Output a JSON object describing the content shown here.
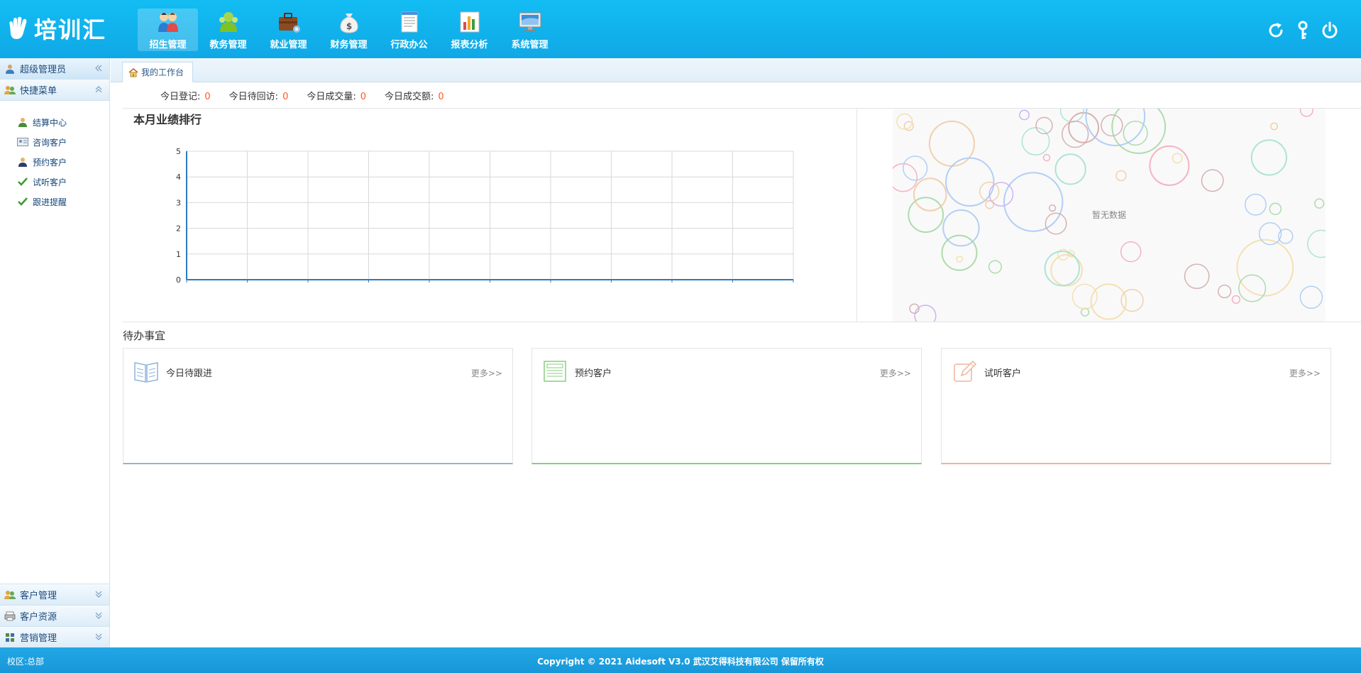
{
  "app": {
    "logo_text": "培训汇"
  },
  "topnav": [
    {
      "label": "招生管理",
      "icon": "students-icon",
      "active": true
    },
    {
      "label": "教务管理",
      "icon": "teachers-icon",
      "active": false
    },
    {
      "label": "就业管理",
      "icon": "briefcase-icon",
      "active": false
    },
    {
      "label": "财务管理",
      "icon": "money-bag-icon",
      "active": false
    },
    {
      "label": "行政办公",
      "icon": "document-icon",
      "active": false
    },
    {
      "label": "报表分析",
      "icon": "bar-chart-icon",
      "active": false
    },
    {
      "label": "系统管理",
      "icon": "monitor-icon",
      "active": false
    }
  ],
  "header_actions": [
    "refresh-icon",
    "key-icon",
    "power-icon"
  ],
  "sidebar": {
    "user_label": "超级管理员",
    "quick_menu_label": "快捷菜单",
    "quick_items": [
      {
        "label": "结算中心",
        "icon": "user-icon"
      },
      {
        "label": "咨询客户",
        "icon": "id-card-icon"
      },
      {
        "label": "预约客户",
        "icon": "user-dark-icon"
      },
      {
        "label": "试听客户",
        "icon": "check-icon"
      },
      {
        "label": "跟进提醒",
        "icon": "check-icon"
      }
    ],
    "bottom_sections": [
      {
        "label": "客户管理",
        "icon": "users-icon"
      },
      {
        "label": "客户资源",
        "icon": "printer-icon"
      },
      {
        "label": "营销管理",
        "icon": "grid-icon"
      }
    ]
  },
  "tabs": [
    {
      "label": "我的工作台",
      "icon": "home-icon"
    }
  ],
  "stats": [
    {
      "label": "今日登记:",
      "value": "0"
    },
    {
      "label": "今日待回访:",
      "value": "0"
    },
    {
      "label": "今日成交量:",
      "value": "0"
    },
    {
      "label": "今日成交额:",
      "value": "0"
    }
  ],
  "chart_data": {
    "type": "bar",
    "title": "本月业绩排行",
    "categories": [
      "",
      "",
      "",
      "",
      "",
      "",
      "",
      "",
      "",
      ""
    ],
    "values": [
      0,
      0,
      0,
      0,
      0,
      0,
      0,
      0,
      0,
      0
    ],
    "yticks": [
      "0",
      "1",
      "2",
      "3",
      "4",
      "5"
    ],
    "ylim": [
      0,
      5
    ],
    "grid": true,
    "color": "#2b7bbd"
  },
  "pie_placeholder": {
    "no_data_text": "暂无数据"
  },
  "todo": {
    "section_title": "待办事宜",
    "cards": [
      {
        "title": "今日待跟进",
        "more": "更多>>",
        "icon": "book-icon",
        "accent": "#8fb4dc"
      },
      {
        "title": "预约客户",
        "more": "更多>>",
        "icon": "news-icon",
        "accent": "#86cf7d"
      },
      {
        "title": "试听客户",
        "more": "更多>>",
        "icon": "pencil-icon",
        "accent": "#f0b49a"
      }
    ]
  },
  "footer": {
    "campus": "校区:总部",
    "copyright": "Copyright © 2021 Aidesoft V3.0 武汉艾得科技有限公司 保留所有权"
  },
  "colors": {
    "header": "#13bdf3",
    "stat_value": "#ff5a1f",
    "footer": "#1897d8"
  }
}
